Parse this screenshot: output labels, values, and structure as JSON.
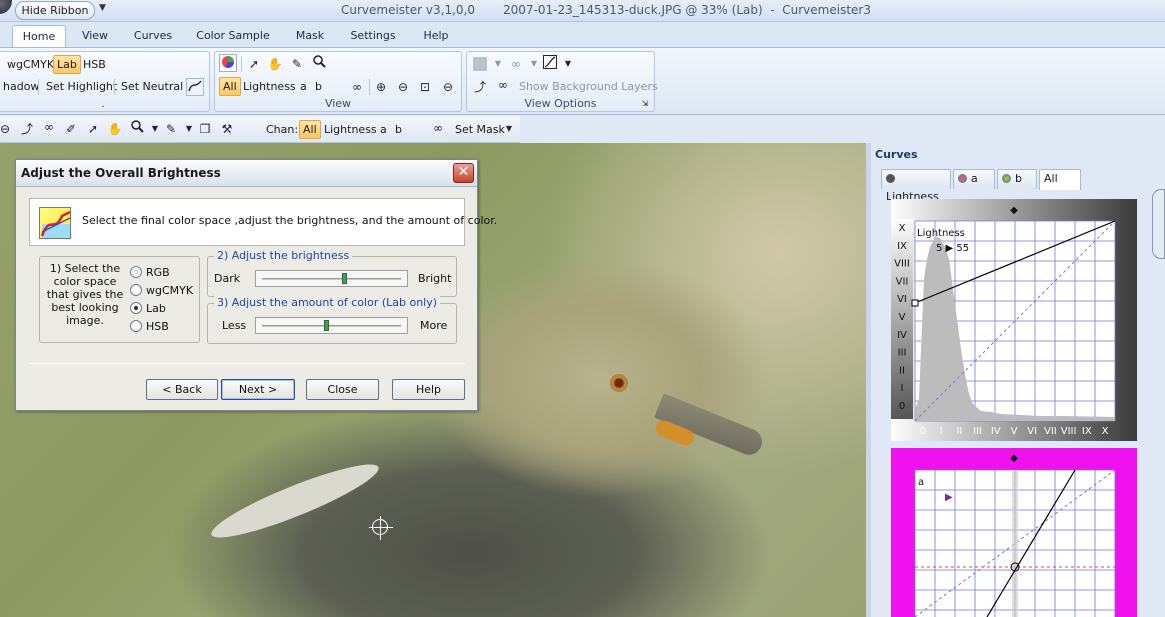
{
  "titlebar": {
    "hide_ribbon_label": "Hide Ribbon",
    "qa_arrow": "▼",
    "app_title": "Curvemeister v3,1,0,0",
    "file_title": "2007-01-23_145313-duck.JPG @ 33% (Lab)  -  Curvemeister3"
  },
  "tabs": [
    {
      "label": "Home",
      "active": true
    },
    {
      "label": "View"
    },
    {
      "label": "Curves"
    },
    {
      "label": "Color Sample"
    },
    {
      "label": "Mask"
    },
    {
      "label": "Settings"
    },
    {
      "label": "Help"
    }
  ],
  "ribbon": {
    "group1": {
      "wgcmyk": "wgCMYK",
      "lab": "Lab",
      "hsb": "HSB",
      "shadow": "hadow",
      "set_highlight": "Set Highlight",
      "set_neutral": "Set Neutral",
      "label": "."
    },
    "group2": {
      "all": "All",
      "lightness": "Lightness",
      "a": "a",
      "b": "b",
      "label": "View"
    },
    "group3": {
      "show_bg_layers": "Show Background Layers",
      "label": "View Options"
    }
  },
  "toolbar2": {
    "chan_label": "Chan:",
    "all": "All",
    "lightness": "Lightness",
    "a": "a",
    "b": "b",
    "set_mask": "Set Mask"
  },
  "dialog": {
    "title": "Adjust the Overall Brightness",
    "close_glyph": "✕",
    "banner_text": "Select the final color space ,adjust the brightness, and the amount of color.",
    "step1_text": "1) Select the color space that gives the best looking image.",
    "options": [
      "RGB",
      "wgCMYK",
      "Lab",
      "HSB"
    ],
    "selected": "Lab",
    "step2_legend": "2) Adjust the brightness",
    "dark": "Dark",
    "bright": "Bright",
    "brightness_value": 0.6,
    "step3_legend": "3) Adjust the amount of color (Lab only)",
    "less": "Less",
    "more": "More",
    "color_value": 0.47,
    "buttons": {
      "back": "< Back",
      "next": "Next >",
      "close": "Close",
      "help": "Help"
    }
  },
  "curves": {
    "title": "Curves",
    "tabs": [
      {
        "label": "Lightness",
        "dot": "#555555"
      },
      {
        "label": "a",
        "dot": "#cc2288"
      },
      {
        "label": "b",
        "dot": "#88aa22"
      },
      {
        "label": "All",
        "active": true
      }
    ],
    "lightness": {
      "channel": "Lightness",
      "readout": "5 ▶ 55",
      "y_ticks": [
        "X",
        "IX",
        "VIII",
        "VII",
        "VI",
        "V",
        "IV",
        "III",
        "II",
        "I",
        "0"
      ],
      "x_ticks": [
        "0",
        "I",
        "II",
        "III",
        "IV",
        "V",
        "VI",
        "VII",
        "VIII",
        "IX",
        "X"
      ]
    },
    "a_channel": {
      "channel": "a"
    }
  },
  "colors": {
    "accent": "#ffc766",
    "dialog_bg": "#ecebe5",
    "magenta": "#ef12ef"
  }
}
